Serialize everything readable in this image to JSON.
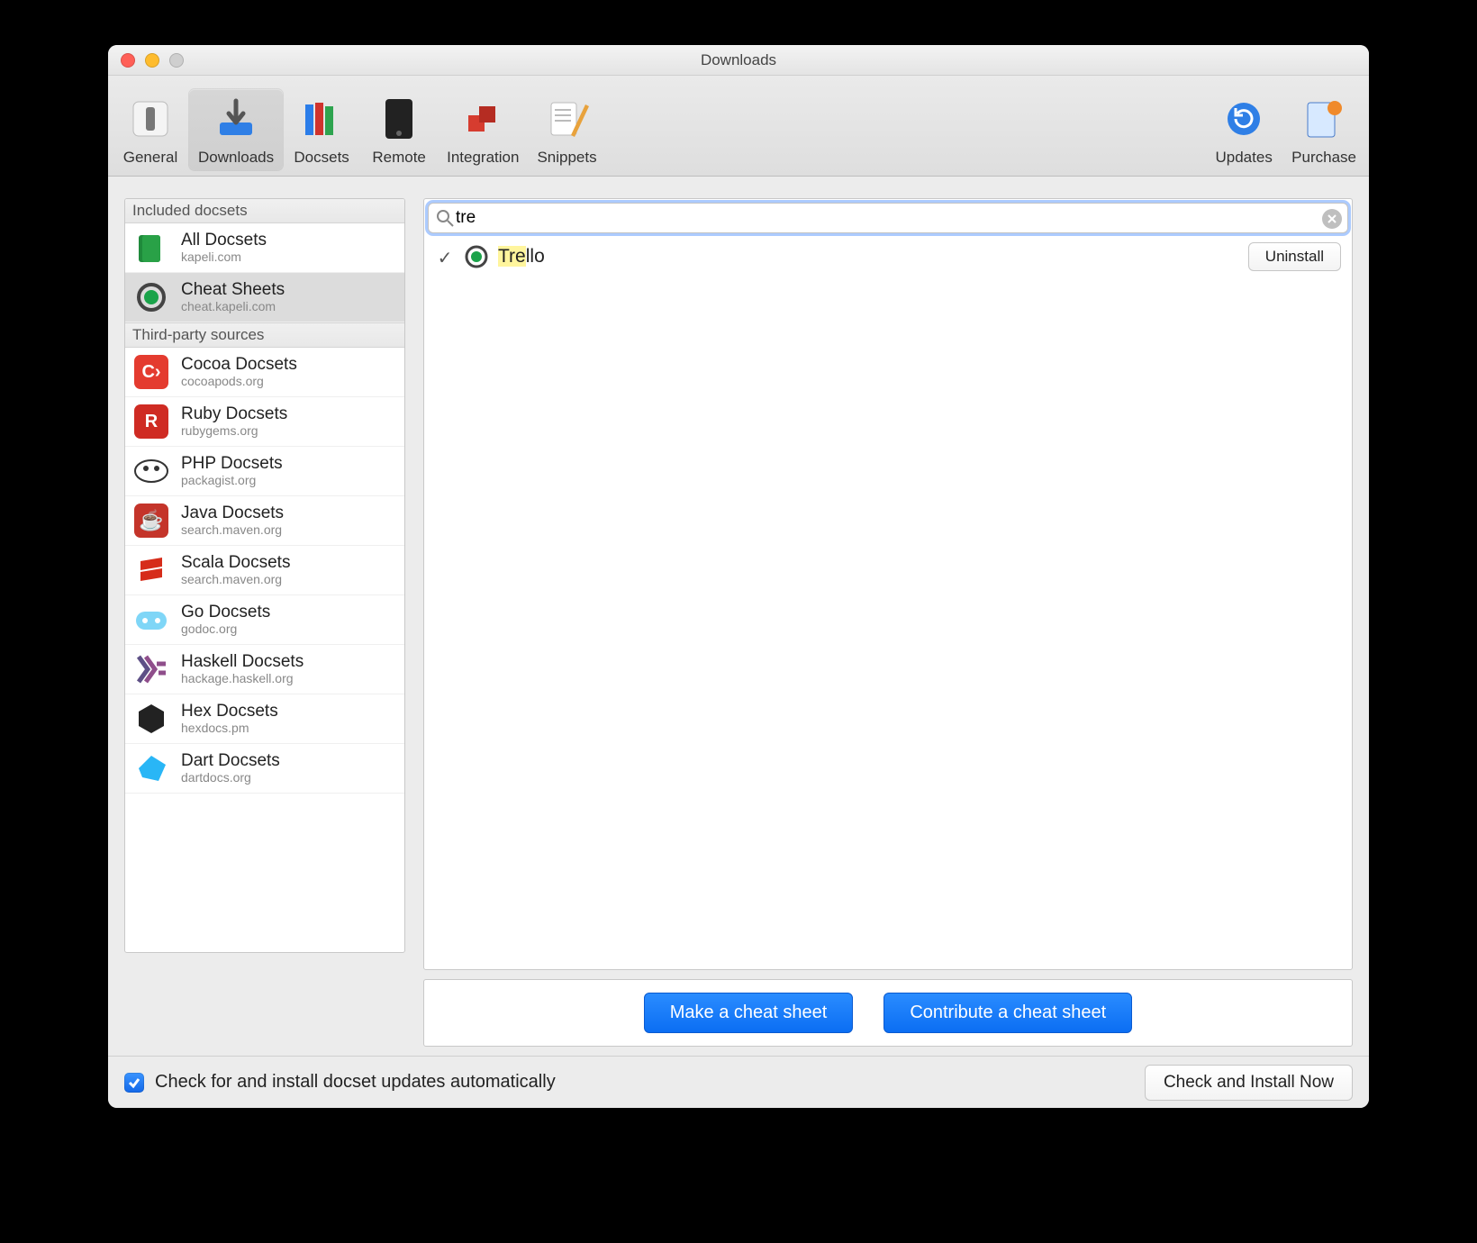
{
  "window": {
    "title": "Downloads"
  },
  "toolbar": {
    "items": [
      {
        "key": "general",
        "label": "General"
      },
      {
        "key": "downloads",
        "label": "Downloads",
        "selected": true
      },
      {
        "key": "docsets",
        "label": "Docsets"
      },
      {
        "key": "remote",
        "label": "Remote"
      },
      {
        "key": "integration",
        "label": "Integration"
      },
      {
        "key": "snippets",
        "label": "Snippets"
      }
    ],
    "right_items": [
      {
        "key": "updates",
        "label": "Updates"
      },
      {
        "key": "purchase",
        "label": "Purchase"
      }
    ]
  },
  "sidebar": {
    "sections": [
      {
        "title": "Included docsets",
        "items": [
          {
            "name": "All Docsets",
            "sub": "kapeli.com",
            "icon": "book-green"
          },
          {
            "name": "Cheat Sheets",
            "sub": "cheat.kapeli.com",
            "icon": "ring-green",
            "selected": true
          }
        ]
      },
      {
        "title": "Third-party sources",
        "items": [
          {
            "name": "Cocoa Docsets",
            "sub": "cocoapods.org",
            "icon": "tile-c"
          },
          {
            "name": "Ruby Docsets",
            "sub": "rubygems.org",
            "icon": "tile-r"
          },
          {
            "name": "PHP Docsets",
            "sub": "packagist.org",
            "icon": "php"
          },
          {
            "name": "Java Docsets",
            "sub": "search.maven.org",
            "icon": "java"
          },
          {
            "name": "Scala Docsets",
            "sub": "search.maven.org",
            "icon": "scala"
          },
          {
            "name": "Go Docsets",
            "sub": "godoc.org",
            "icon": "go"
          },
          {
            "name": "Haskell Docsets",
            "sub": "hackage.haskell.org",
            "icon": "haskell"
          },
          {
            "name": "Hex Docsets",
            "sub": "hexdocs.pm",
            "icon": "hex"
          },
          {
            "name": "Dart Docsets",
            "sub": "dartdocs.org",
            "icon": "dart"
          }
        ]
      }
    ]
  },
  "search": {
    "value": "tre"
  },
  "results": [
    {
      "installed": true,
      "label_prefix": "Tre",
      "label_suffix": "llo",
      "uninstall_label": "Uninstall"
    }
  ],
  "actions": {
    "make_label": "Make a cheat sheet",
    "contribute_label": "Contribute a cheat sheet"
  },
  "footer": {
    "auto_update_checked": true,
    "auto_update_label": "Check for and install docset updates automatically",
    "check_now_label": "Check and Install Now"
  }
}
